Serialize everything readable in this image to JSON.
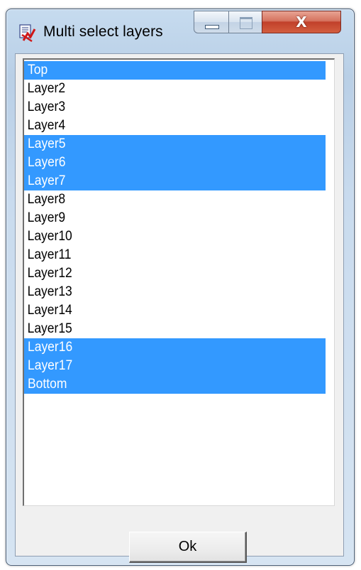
{
  "window": {
    "title": "Multi select layers",
    "icon": "layers-app-icon",
    "close_glyph": "X"
  },
  "colors": {
    "selection": "#3399ff",
    "selection_text": "#ffffff",
    "close_button": "#c1402a"
  },
  "layers": [
    {
      "label": "Top",
      "selected": true
    },
    {
      "label": "Layer2",
      "selected": false
    },
    {
      "label": "Layer3",
      "selected": false
    },
    {
      "label": "Layer4",
      "selected": false
    },
    {
      "label": "Layer5",
      "selected": true
    },
    {
      "label": "Layer6",
      "selected": true
    },
    {
      "label": "Layer7",
      "selected": true
    },
    {
      "label": "Layer8",
      "selected": false
    },
    {
      "label": "Layer9",
      "selected": false
    },
    {
      "label": "Layer10",
      "selected": false
    },
    {
      "label": "Layer11",
      "selected": false
    },
    {
      "label": "Layer12",
      "selected": false
    },
    {
      "label": "Layer13",
      "selected": false
    },
    {
      "label": "Layer14",
      "selected": false
    },
    {
      "label": "Layer15",
      "selected": false
    },
    {
      "label": "Layer16",
      "selected": true
    },
    {
      "label": "Layer17",
      "selected": true
    },
    {
      "label": "Bottom",
      "selected": true
    }
  ],
  "buttons": {
    "ok_label": "Ok"
  }
}
